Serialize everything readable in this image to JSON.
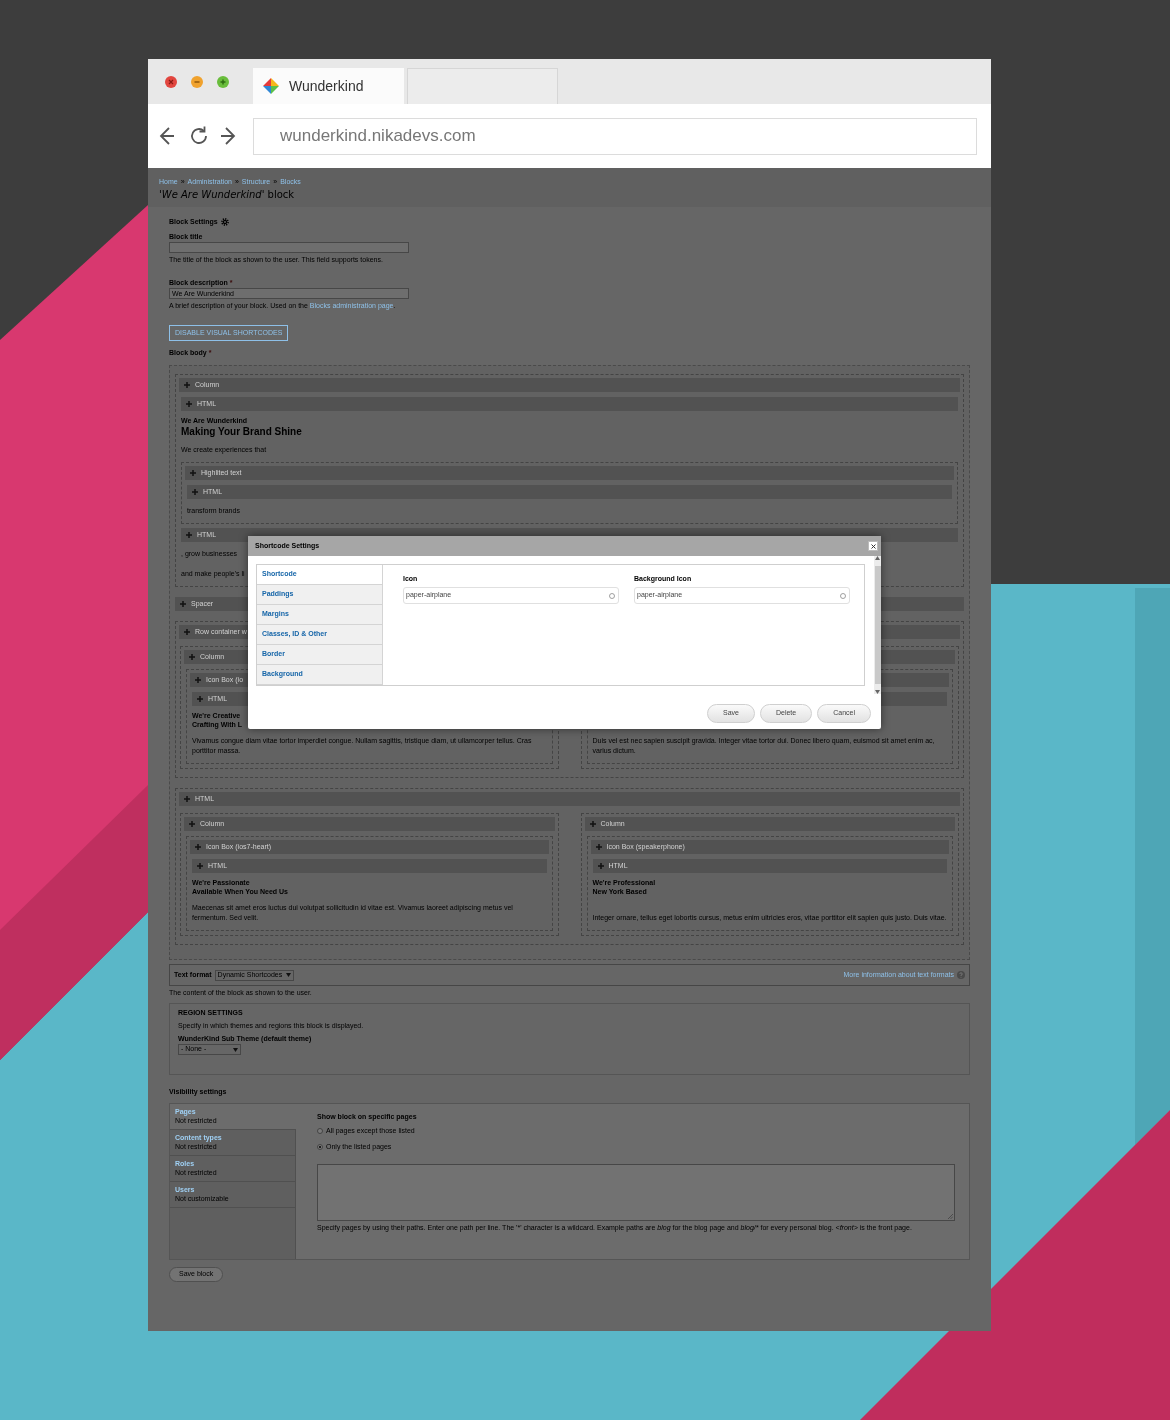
{
  "browser": {
    "tab_title": "Wunderkind",
    "url": "wunderkind.nikadevs.com"
  },
  "breadcrumb": [
    {
      "kind": "link",
      "label": "Home"
    },
    {
      "kind": "separator",
      "label": "»"
    },
    {
      "kind": "link",
      "label": "Administration"
    },
    {
      "kind": "separator",
      "label": "»"
    },
    {
      "kind": "link",
      "label": "Structure"
    },
    {
      "kind": "separator",
      "label": "»"
    },
    {
      "kind": "link",
      "label": "Blocks"
    }
  ],
  "page_title": "'*We Are Wunderkind'* block",
  "settings_heading": "Block Settings",
  "fields": [
    {
      "label": "Block title",
      "help": [
        {
          "text": "The title of the block as shown to the user. This field supports tokens."
        }
      ]
    },
    {
      "label": "Block description",
      "required_mark": "*",
      "value": "We Are Wunderkind",
      "help": [
        {
          "text": "A brief description of your block. Used on the "
        },
        {
          "text": "Blocks administration page",
          "kind": "link"
        },
        {
          "text": "."
        }
      ]
    }
  ],
  "toggle_button": "DISABLE VISUAL SHORTCODES",
  "body_label": "Block body",
  "body_required_mark": "*",
  "editor": [
    {
      "kind": "element",
      "label": "Column",
      "children": [
        {
          "kind": "element",
          "label": "HTML"
        },
        {
          "kind": "title",
          "text": "We Are Wunderkind"
        },
        {
          "kind": "headline",
          "text": "Making Your Brand Shine"
        },
        {
          "kind": "text",
          "text": "We create experiences that"
        },
        {
          "kind": "element",
          "label": "Highlited text",
          "children": [
            {
              "kind": "element",
              "label": "HTML"
            },
            {
              "kind": "text",
              "text": "transform brands"
            }
          ]
        },
        {
          "kind": "element",
          "label": "HTML"
        },
        {
          "kind": "text",
          "text": ", grow businesses"
        },
        {
          "kind": "text",
          "text": "and make people's li"
        }
      ]
    },
    {
      "kind": "element",
      "label": "Spacer"
    },
    {
      "kind": "row",
      "label": "Row container w",
      "children": [
        {
          "kind": "element",
          "label": "Column",
          "children": [
            {
              "kind": "element",
              "label": "Icon Box",
              "note": "(io",
              "children": [
                {
                  "kind": "element",
                  "label": "HTML"
                },
                {
                  "kind": "title",
                  "text": "We're Creative"
                },
                {
                  "kind": "subtitle",
                  "text": "Crafting With L"
                },
                {
                  "kind": "text",
                  "text": "Vivamus congue diam vitae tortor imperdiet congue. Nullam sagittis, tristique diam, ut ullamcorper tellus. Cras porttitor massa."
                }
              ]
            }
          ]
        },
        {
          "kind": "element",
          "children": [
            {
              "kind": "element",
              "children": [
                {
                  "kind": "element"
                },
                {
                  "kind": "text",
                  "text": "Duis vel est nec sapien suscipit gravida. Integer vitae tortor dui. Donec libero quam, euismod sit amet enim ac, varius dictum."
                }
              ]
            }
          ]
        }
      ]
    },
    {
      "kind": "row",
      "label": "HTML",
      "children": [
        {
          "kind": "element",
          "label": "Column",
          "children": [
            {
              "kind": "element",
              "label": "Icon Box",
              "note": "(ios7-heart)",
              "children": [
                {
                  "kind": "element",
                  "label": "HTML"
                },
                {
                  "kind": "title",
                  "text": "We're Passionate"
                },
                {
                  "kind": "subtitle",
                  "text": "Available When You Need Us"
                },
                {
                  "kind": "text",
                  "text": "Maecenas sit amet eros luctus dui volutpat sollicitudin id vitae est. Vivamus laoreet adipiscing metus vel fermentum. Sed velit."
                }
              ]
            }
          ]
        },
        {
          "kind": "element",
          "label": "Column",
          "children": [
            {
              "kind": "element",
              "label": "Icon Box",
              "note": "(speakerphone)",
              "children": [
                {
                  "kind": "element",
                  "label": "HTML"
                },
                {
                  "kind": "title",
                  "text": "We're Professional"
                },
                {
                  "kind": "subtitle",
                  "text": "New York Based"
                },
                {
                  "kind": "text",
                  "text": "Integer ornare, tellus eget lobortis cursus, metus enim ultricies eros, vitae porttitor elit sapien quis justo. Duis vitae."
                }
              ]
            }
          ]
        }
      ]
    }
  ],
  "text_format": {
    "label": "Text format",
    "value": "Dynamic Shortcodes",
    "link": "More information about text formats",
    "help": "The content of the block as shown to the user."
  },
  "region_settings": {
    "legend": "REGION SETTINGS",
    "description": "Specify in which themes and regions this block is displayed.",
    "theme_label": "WunderKind Sub Theme (default theme)",
    "value": "- None -"
  },
  "visibility": {
    "heading": "Visibility settings",
    "tabs": [
      {
        "title": "Pages",
        "summary": "Not restricted",
        "selected": true
      },
      {
        "title": "Content types",
        "summary": "Not restricted",
        "selected": false
      },
      {
        "title": "Roles",
        "summary": "Not restricted",
        "selected": false
      },
      {
        "title": "Users",
        "summary": "Not customizable",
        "selected": false
      }
    ],
    "pane_heading": "Show block on specific pages",
    "options": [
      {
        "label": "All pages except those listed",
        "selected": false
      },
      {
        "label": "Only the listed pages",
        "selected": true
      }
    ],
    "help": [
      {
        "text": "Specify pages by using their paths. Enter one path per line. The '*' character is a wildcard. Example paths are "
      },
      {
        "text": "blog",
        "italic": true
      },
      {
        "text": " for the blog page and "
      },
      {
        "text": "blog/*",
        "italic": true
      },
      {
        "text": " for every personal blog. "
      },
      {
        "text": "<front>",
        "italic": true
      },
      {
        "text": " is the front page."
      }
    ]
  },
  "save_button": "Save block",
  "modal": {
    "title": "Shortcode Settings",
    "tabs": [
      {
        "label": "Shortcode",
        "selected": true
      },
      {
        "label": "Paddings",
        "selected": false
      },
      {
        "label": "Margins",
        "selected": false
      },
      {
        "label": "Classes, ID & Other",
        "selected": false
      },
      {
        "label": "Border",
        "selected": false
      },
      {
        "label": "Background",
        "selected": false
      }
    ],
    "fields": [
      {
        "label": "Icon",
        "value": "paper-airplane"
      },
      {
        "label": "Background Icon",
        "value": "paper-airplane"
      }
    ],
    "buttons": [
      "Save",
      "Delete",
      "Cancel"
    ]
  }
}
